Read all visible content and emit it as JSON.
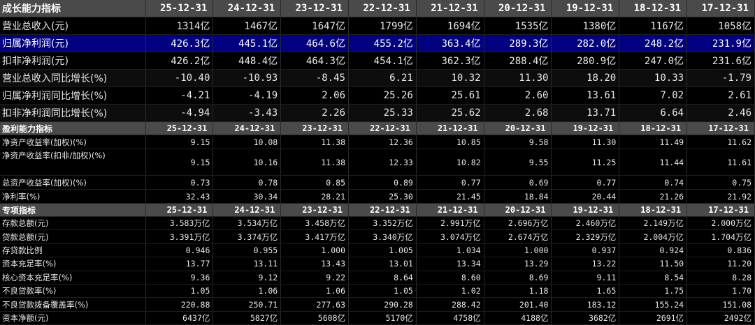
{
  "sections": [
    {
      "title": "成长能力指标",
      "dates": [
        "25-12-31",
        "24-12-31",
        "23-12-31",
        "22-12-31",
        "21-12-31",
        "20-12-31",
        "19-12-31",
        "18-12-31",
        "17-12-31"
      ],
      "rows": [
        {
          "label": "营业总收入(元)",
          "values": [
            "1314亿",
            "1467亿",
            "1647亿",
            "1799亿",
            "1694亿",
            "1535亿",
            "1380亿",
            "1167亿",
            "1058亿"
          ]
        },
        {
          "label": "归属净利润(元)",
          "values": [
            "426.3亿",
            "445.1亿",
            "464.6亿",
            "455.2亿",
            "363.4亿",
            "289.3亿",
            "282.0亿",
            "248.2亿",
            "231.9亿"
          ],
          "selected": true
        },
        {
          "label": "扣非净利润(元)",
          "values": [
            "426.2亿",
            "448.4亿",
            "464.3亿",
            "454.1亿",
            "362.3亿",
            "288.4亿",
            "280.9亿",
            "247.0亿",
            "231.6亿"
          ]
        },
        {
          "label": "营业总收入同比增长(%)",
          "values": [
            "-10.40",
            "-10.93",
            "-8.45",
            "6.21",
            "10.32",
            "11.30",
            "18.20",
            "10.33",
            "-1.79"
          ]
        },
        {
          "label": "归属净利润同比增长(%)",
          "values": [
            "-4.21",
            "-4.19",
            "2.06",
            "25.26",
            "25.61",
            "2.60",
            "13.61",
            "7.02",
            "2.61"
          ]
        },
        {
          "label": "扣非净利润同比增长(%)",
          "values": [
            "-4.94",
            "-3.43",
            "2.26",
            "25.33",
            "25.62",
            "2.68",
            "13.71",
            "6.64",
            "2.46"
          ]
        }
      ]
    },
    {
      "title": "盈利能力指标",
      "dates": [
        "25-12-31",
        "24-12-31",
        "23-12-31",
        "22-12-31",
        "21-12-31",
        "20-12-31",
        "19-12-31",
        "18-12-31",
        "17-12-31"
      ],
      "rows": [
        {
          "label": "净资产收益率(加权)(%)",
          "values": [
            "9.15",
            "10.08",
            "11.38",
            "12.36",
            "10.85",
            "9.58",
            "11.30",
            "11.49",
            "11.62"
          ]
        },
        {
          "label": "净资产收益率(扣非/加权)(%)",
          "values": [
            "9.15",
            "10.16",
            "11.38",
            "12.33",
            "10.82",
            "9.55",
            "11.25",
            "11.44",
            "11.61"
          ],
          "tall": true
        },
        {
          "label": "总资产收益率(加权)(%)",
          "values": [
            "0.73",
            "0.78",
            "0.85",
            "0.89",
            "0.77",
            "0.69",
            "0.77",
            "0.74",
            "0.75"
          ]
        },
        {
          "label": "净利率(%)",
          "values": [
            "32.43",
            "30.34",
            "28.21",
            "25.30",
            "21.45",
            "18.84",
            "20.44",
            "21.26",
            "21.92"
          ]
        }
      ]
    },
    {
      "title": "专项指标",
      "dates": [
        "25-12-31",
        "24-12-31",
        "23-12-31",
        "22-12-31",
        "21-12-31",
        "20-12-31",
        "19-12-31",
        "18-12-31",
        "17-12-31"
      ],
      "rows": [
        {
          "label": "存款总额(元)",
          "values": [
            "3.583万亿",
            "3.534万亿",
            "3.458万亿",
            "3.352万亿",
            "2.991万亿",
            "2.696万亿",
            "2.460万亿",
            "2.149万亿",
            "2.000万亿"
          ]
        },
        {
          "label": "贷款总额(元)",
          "values": [
            "3.391万亿",
            "3.374万亿",
            "3.417万亿",
            "3.340万亿",
            "3.074万亿",
            "2.674万亿",
            "2.329万亿",
            "2.004万亿",
            "1.704万亿"
          ]
        },
        {
          "label": "存贷款比例",
          "values": [
            "0.946",
            "0.955",
            "1.000",
            "1.005",
            "1.034",
            "1.000",
            "0.937",
            "0.924",
            "0.836"
          ]
        },
        {
          "label": "资本充足率(%)",
          "values": [
            "13.77",
            "13.11",
            "13.43",
            "13.01",
            "13.34",
            "13.29",
            "13.22",
            "11.50",
            "11.20"
          ]
        },
        {
          "label": "核心资本充足率(%)",
          "values": [
            "9.36",
            "9.12",
            "9.22",
            "8.64",
            "8.60",
            "8.69",
            "9.11",
            "8.54",
            "8.28"
          ]
        },
        {
          "label": "不良贷款率(%)",
          "values": [
            "1.05",
            "1.06",
            "1.06",
            "1.05",
            "1.02",
            "1.18",
            "1.65",
            "1.75",
            "1.70"
          ]
        },
        {
          "label": "不良贷款拨备覆盖率(%)",
          "values": [
            "220.88",
            "250.71",
            "277.63",
            "290.28",
            "288.42",
            "201.40",
            "183.12",
            "155.24",
            "151.08"
          ]
        },
        {
          "label": "资本净额(元)",
          "values": [
            "6437亿",
            "5827亿",
            "5608亿",
            "5170亿",
            "4758亿",
            "4188亿",
            "3682亿",
            "2691亿",
            "2492亿"
          ]
        }
      ]
    }
  ]
}
